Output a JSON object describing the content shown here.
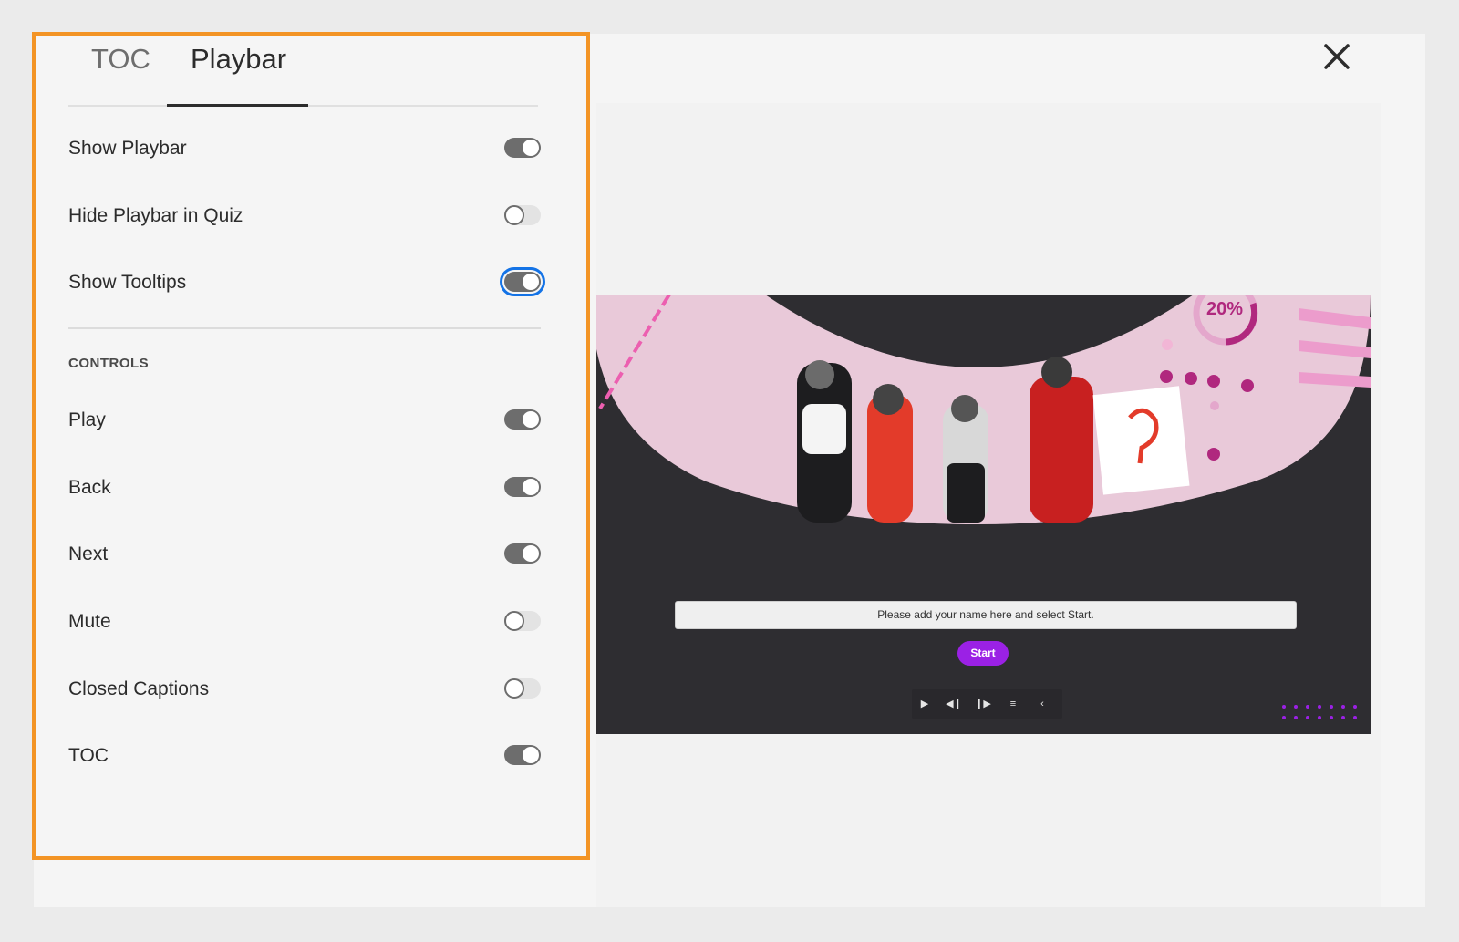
{
  "tabs": {
    "toc": "TOC",
    "playbar": "Playbar"
  },
  "settings": [
    {
      "label": "Show Playbar",
      "state": "on"
    },
    {
      "label": "Hide Playbar in Quiz",
      "state": "off"
    },
    {
      "label": "Show Tooltips",
      "state": "on"
    }
  ],
  "controls": {
    "title": "CONTROLS",
    "items": [
      {
        "label": "Play",
        "state": "on"
      },
      {
        "label": "Back",
        "state": "on"
      },
      {
        "label": "Next",
        "state": "on"
      },
      {
        "label": "Mute",
        "state": "off"
      },
      {
        "label": "Closed Captions",
        "state": "off"
      },
      {
        "label": "TOC",
        "state": "on"
      }
    ]
  },
  "preview": {
    "badge_percent": "20%",
    "name_placeholder": "Please add your name here and select Start.",
    "start_label": "Start",
    "playbar_icons": [
      "play-icon",
      "back-icon",
      "next-icon",
      "toc-menu-icon",
      "collapse-icon"
    ],
    "playbar_glyphs": [
      "▶",
      "◀❙",
      "❙▶",
      "≡",
      "‹"
    ]
  },
  "colors": {
    "highlight": "#f39425",
    "accent": "#9b21e5",
    "toggle_on": "#6d6d6d",
    "focus": "#1473e6"
  },
  "icons": {
    "close": "close-icon"
  }
}
